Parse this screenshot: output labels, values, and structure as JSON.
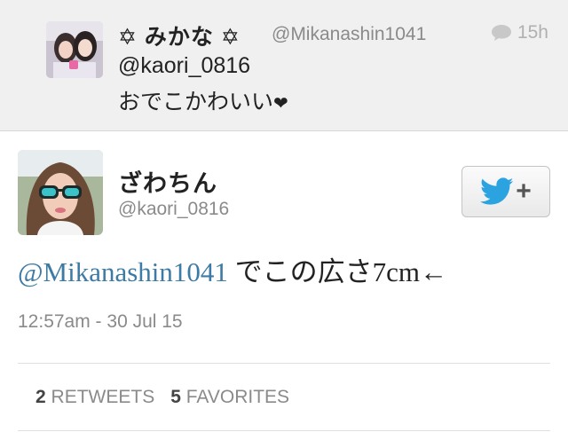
{
  "reply": {
    "name": "✡ みかな ✡",
    "handle": "@Mikanashin1041",
    "time": "15h",
    "line1": "@kaori_0816",
    "line2": "おでこかわいい",
    "line2_emoji": "❤",
    "icon": "speech-bubble-icon"
  },
  "tweet": {
    "name": "ざわちん",
    "handle": "@kaori_0816",
    "mention": "@Mikanashin1041",
    "text": " でこの広さ7cm←",
    "timestamp": "12:57am - 30 Jul 15",
    "follow_icon": "twitter-bird-icon",
    "follow_plus": "+"
  },
  "stats": {
    "retweets_count": "2",
    "retweets_label": "RETWEETS",
    "favorites_count": "5",
    "favorites_label": "FAVORITES"
  },
  "colors": {
    "mention": "#3d7ba5",
    "twitter_blue": "#2aa3e0",
    "muted": "#8a8a8a"
  }
}
